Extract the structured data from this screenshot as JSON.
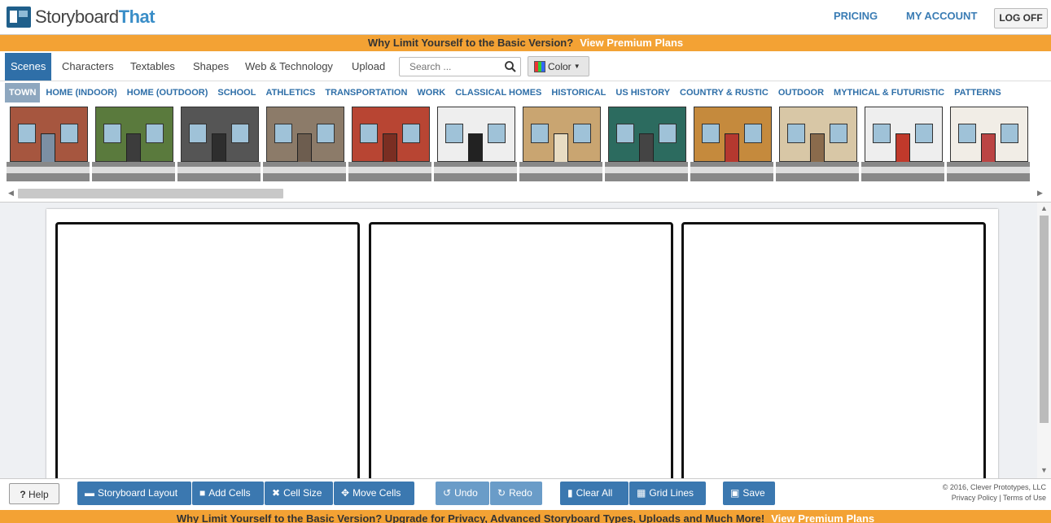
{
  "header": {
    "logo_plain": "Storyboard",
    "logo_bold": "That",
    "links": [
      "PRICING",
      "MY ACCOUNT"
    ],
    "logoff": "LOG OFF"
  },
  "promo_top": {
    "text": "Why Limit Yourself to the Basic Version?",
    "link": "View Premium Plans"
  },
  "tabs": [
    "Scenes",
    "Characters",
    "Textables",
    "Shapes",
    "Web & Technology",
    "Upload"
  ],
  "search": {
    "placeholder": "Search ..."
  },
  "color_button": "Color",
  "categories": [
    "TOWN",
    "HOME (INDOOR)",
    "HOME (OUTDOOR)",
    "SCHOOL",
    "ATHLETICS",
    "TRANSPORTATION",
    "WORK",
    "CLASSICAL HOMES",
    "HISTORICAL",
    "US HISTORY",
    "COUNTRY & RUSTIC",
    "OUTDOOR",
    "MYTHICAL & FUTURISTIC",
    "PATTERNS"
  ],
  "toolbar": {
    "help": "Help",
    "buttons": [
      "Storyboard Layout",
      "Add Cells",
      "Cell Size",
      "Move Cells",
      "Undo",
      "Redo",
      "Clear All",
      "Grid Lines",
      "Save"
    ]
  },
  "footer": {
    "copyright": "© 2016, Clever Prototypes, LLC",
    "privacy": "Privacy Policy",
    "terms": "Terms of Use",
    "separator": "|"
  },
  "promo_bottom": {
    "text": "Why Limit Yourself to the Basic Version? Upgrade for Privacy, Advanced Storyboard Types, Uploads and Much More!",
    "link": "View Premium Plans"
  },
  "colors": {
    "accent_blue": "#2f6fa8",
    "promo_orange": "#f3a234",
    "toolbar_blue": "#3b78b0"
  }
}
